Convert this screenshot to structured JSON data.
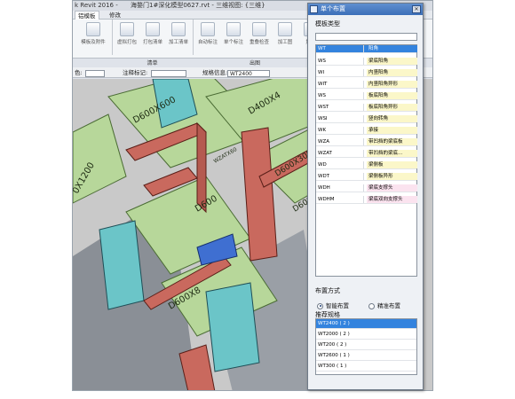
{
  "window": {
    "app_title": "k Revit 2016 -",
    "doc_title": "海婺门1#深化模型0627.rvt - 三维视图: {三维}"
  },
  "tabs": [
    {
      "label": "铝模板"
    },
    {
      "label": "修改"
    }
  ],
  "ribbon": {
    "buttons": [
      {
        "label": "模板及附件"
      },
      {
        "label": "虚拟打包"
      },
      {
        "label": "打包清单"
      },
      {
        "label": "加工清单"
      },
      {
        "label": "自动标注"
      },
      {
        "label": "单个标注"
      },
      {
        "label": "重叠检查"
      },
      {
        "label": "加工图"
      },
      {
        "label": "加工"
      }
    ],
    "groups": [
      {
        "label": "清单"
      },
      {
        "label": "出图"
      }
    ]
  },
  "options_bar": {
    "color_label": "色:",
    "annotation_label": "注释标记:",
    "spec_label": "规格信息:",
    "spec_value": "WT2400"
  },
  "model_labels": [
    "D600X600",
    "D400X4",
    "D600X300",
    "WZATX60",
    "D600",
    "D600X8",
    "D600X600",
    "0X1200"
  ],
  "panel": {
    "title": "单个布置",
    "template_type_label": "模板类型",
    "template_types": [
      {
        "code": "WT",
        "name": "阳角",
        "selected": true
      },
      {
        "code": "WS",
        "name": "梁底阳角"
      },
      {
        "code": "WI",
        "name": "内竖阳角"
      },
      {
        "code": "WIT",
        "name": "内竖阳角异形"
      },
      {
        "code": "WS",
        "name": "板底阳角"
      },
      {
        "code": "WST",
        "name": "板底阳角异形"
      },
      {
        "code": "WSI",
        "name": "竖向转角"
      },
      {
        "code": "WK",
        "name": "承接"
      },
      {
        "code": "WZA",
        "name": "带凹挡的梁底板"
      },
      {
        "code": "WZAT",
        "name": "带凹挡的梁底..."
      },
      {
        "code": "WD",
        "name": "梁侧板"
      },
      {
        "code": "WDT",
        "name": "梁侧板异形"
      },
      {
        "code": "WDH",
        "name": "梁底支撑头",
        "pink": true
      },
      {
        "code": "WDHM",
        "name": "梁底双向支撑头",
        "pink": true
      }
    ],
    "layout_mode_label": "布置方式",
    "layout_modes": [
      {
        "label": "智能布置",
        "checked": true
      },
      {
        "label": "精准布置",
        "checked": false
      }
    ],
    "recommended_label": "推荐规格",
    "recommended": [
      {
        "label": "WT2400 ( 2 )",
        "selected": true
      },
      {
        "label": "WT2000 ( 2 )"
      },
      {
        "label": "WT200 ( 2 )"
      },
      {
        "label": "WT2600 ( 1 )"
      },
      {
        "label": "WT300 ( 1 )"
      }
    ]
  }
}
